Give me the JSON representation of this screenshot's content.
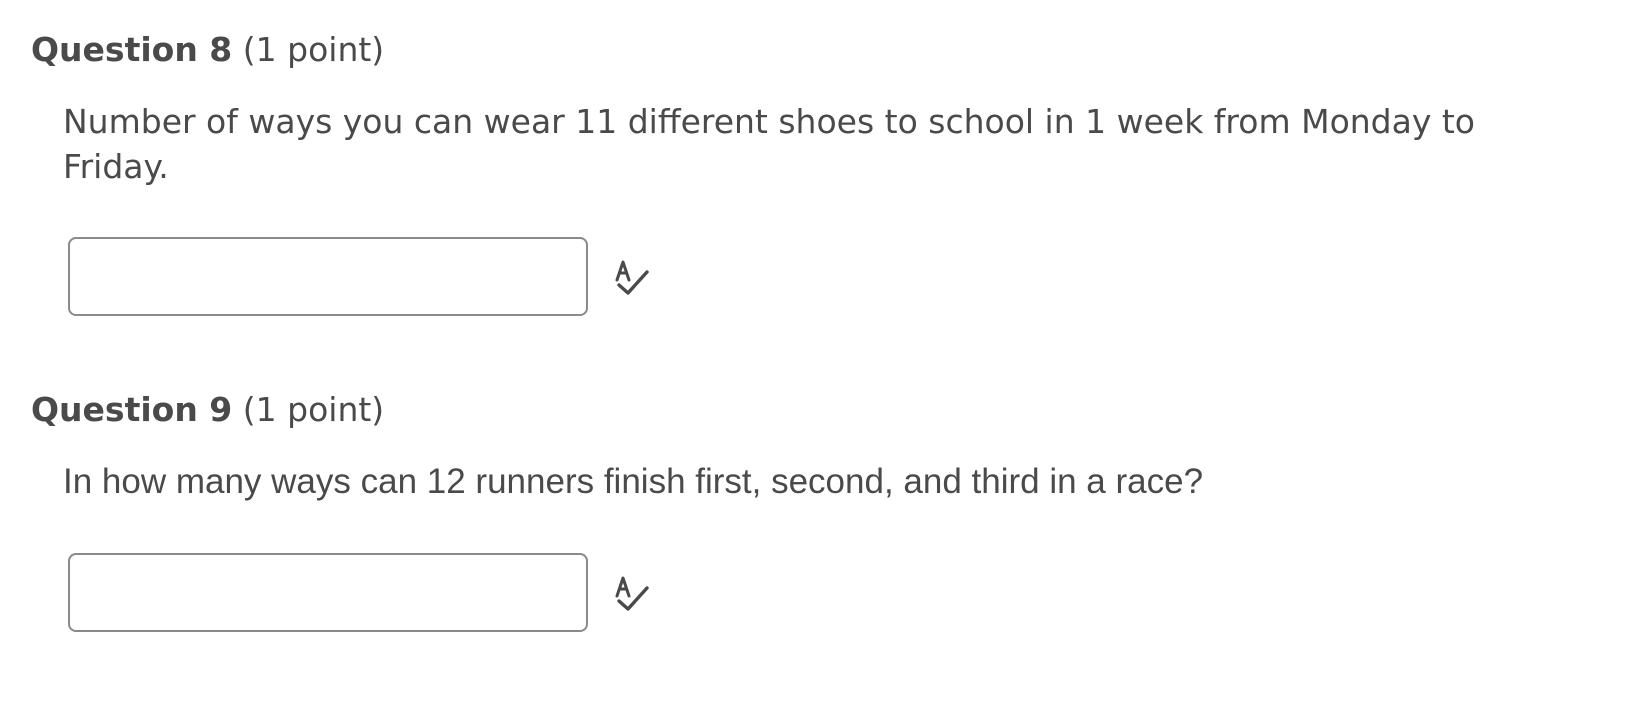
{
  "questions": [
    {
      "title": "Question 8",
      "points": "(1 point)",
      "prompt": "Number of ways you can wear 11 different shoes to school in 1 week from Monday to Friday.",
      "answer_value": "",
      "icon": "spell-check-icon"
    },
    {
      "title": "Question 9",
      "points": "(1 point)",
      "prompt": "In how many ways can 12 runners finish first, second, and third in a race?",
      "answer_value": "",
      "icon": "spell-check-icon"
    }
  ],
  "colors": {
    "text": "#4a4a4a",
    "input_border": "#8a8a8a",
    "icon": "#4a4a4a"
  }
}
